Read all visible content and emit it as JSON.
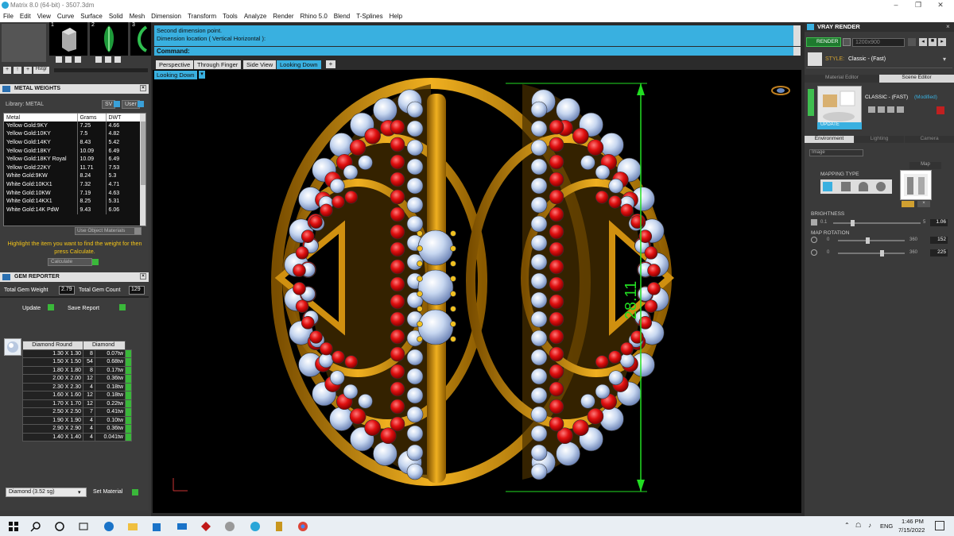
{
  "window": {
    "title": "Matrix 8.0 (64-bit) - 3507.3dm"
  },
  "menu": [
    "File",
    "Edit",
    "View",
    "Curve",
    "Surface",
    "Solid",
    "Mesh",
    "Dimension",
    "Transform",
    "Tools",
    "Analyze",
    "Render",
    "Rhino 5.0",
    "Blend",
    "T-Splines",
    "Help"
  ],
  "history_btn": "Hstgr",
  "thumb_numbers": [
    "1",
    "2",
    "3"
  ],
  "metal_weights": {
    "title": "METAL WEIGHTS",
    "library_label": "Library: METAL",
    "sv_btn": "SV",
    "user_btn": "User",
    "headers": [
      "Metal",
      "Grams",
      "DWT"
    ],
    "rows": [
      [
        "Yellow Gold:9KY",
        "7.25",
        "4.66"
      ],
      [
        "Yellow Gold:10KY",
        "7.5",
        "4.82"
      ],
      [
        "Yellow Gold:14KY",
        "8.43",
        "5.42"
      ],
      [
        "Yellow Gold:18KY",
        "10.09",
        "6.49"
      ],
      [
        "Yellow Gold:18KY Royal",
        "10.09",
        "6.49"
      ],
      [
        "Yellow Gold:22KY",
        "11.71",
        "7.53"
      ],
      [
        "White Gold:9KW",
        "8.24",
        "5.3"
      ],
      [
        "White Gold:10KX1",
        "7.32",
        "4.71"
      ],
      [
        "White Gold:10KW",
        "7.19",
        "4.63"
      ],
      [
        "White Gold:14KX1",
        "8.25",
        "5.31"
      ],
      [
        "White Gold:14K PdW",
        "9.43",
        "6.06"
      ]
    ],
    "use_object_materials": "Use Object Materials",
    "hint": "Highlight the item you want to find the weight for then press Calculate.",
    "calculate": "Calculate"
  },
  "gem_reporter": {
    "title": "GEM REPORTER",
    "total_weight_label": "Total Gem Weight",
    "total_weight": "2.79",
    "total_count_label": "Total Gem Count",
    "total_count": "129",
    "update": "Update",
    "save_report": "Save Report",
    "col1": "Diamond Round",
    "col2": "Diamond",
    "rows": [
      [
        "1.30 X 1.30",
        "8",
        "0.07tw"
      ],
      [
        "1.50 X 1.50",
        "54",
        "0.68tw"
      ],
      [
        "1.80 X 1.80",
        "8",
        "0.17tw"
      ],
      [
        "2.00 X 2.00",
        "12",
        "0.36tw"
      ],
      [
        "2.30 X 2.30",
        "4",
        "0.18tw"
      ],
      [
        "1.60 X 1.60",
        "12",
        "0.18tw"
      ],
      [
        "1.70 X 1.70",
        "12",
        "0.22tw"
      ],
      [
        "2.50 X 2.50",
        "7",
        "0.41tw"
      ],
      [
        "1.90 X 1.90",
        "4",
        "0.10tw"
      ],
      [
        "2.90 X 2.90",
        "4",
        "0.36tw"
      ],
      [
        "1.40 X 1.40",
        "4",
        "0.041tw"
      ]
    ],
    "material_select": "Diamond    (3.52 sg)",
    "set_material": "Set Material"
  },
  "command": {
    "line1": "Second dimension point.",
    "line2": "Dimension location ( Vertical  Horizontal ):",
    "prompt": "Command:"
  },
  "tabs": [
    "Perspective",
    "Through Finger",
    "Side View",
    "Looking Down"
  ],
  "active_tab": "Looking Down",
  "viewport_label": "Looking Down",
  "dimension_value": "28.11",
  "vray": {
    "title": "VRAY RENDER",
    "render_btn": "RENDER",
    "resolution": "1200x900",
    "style_label": "STYLE:",
    "style_value": "Classic - (Fast)",
    "tab_material": "Material Editor",
    "tab_scene": "Scene Editor",
    "preset_name": "CLASSIC - (FAST)",
    "preset_modified": "(Modified)",
    "update": "UPDATE",
    "subtab_env": "Environment",
    "subtab_light": "Lighting",
    "subtab_cam": "Camera",
    "image_select": "Image",
    "mapping_type": "MAPPING TYPE",
    "map_label": "Map",
    "brightness_label": "BRIGHTNESS",
    "brightness_min": "0.1",
    "brightness_max": "5",
    "brightness_value": "1.06",
    "map_rotation_label": "MAP ROTATION",
    "rot1_min": "0",
    "rot1_max": "360",
    "rot1_value": "152",
    "rot2_min": "0",
    "rot2_max": "360",
    "rot2_value": "225"
  },
  "taskbar": {
    "lang": "ENG",
    "time": "1:46 PM",
    "date": "7/15/2022"
  }
}
